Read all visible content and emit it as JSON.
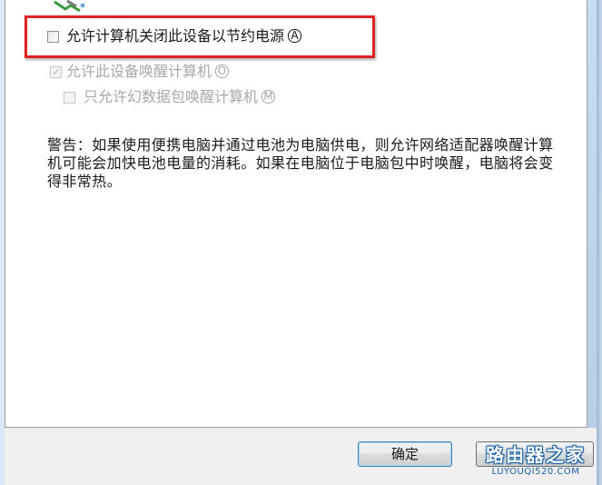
{
  "options": {
    "allow_power_off": {
      "label": "允许计算机关闭此设备以节约电源",
      "hotkey": "A",
      "checked": false
    },
    "allow_wake": {
      "label": "允许此设备唤醒计算机",
      "hotkey": "O",
      "checked": true,
      "disabled": true
    },
    "magic_packet_only": {
      "label": "只允许幻数据包唤醒计算机",
      "hotkey": "M",
      "checked": false,
      "disabled": true
    }
  },
  "warning_text": "警告：如果使用便携电脑并通过电池为电脑供电，则允许网络适配器唤醒计算机可能会加快电池电量的消耗。如果在电脑位于电脑包中时唤醒，电脑将会变得非常热。",
  "buttons": {
    "ok_label": "确定",
    "cancel_label": ""
  },
  "watermark": {
    "title": "路由器之家",
    "url": "LUYOUQI520.COM"
  },
  "colors": {
    "highlight": "#e02222",
    "default_button_border": "#3c7fb1",
    "watermark_blue": "#1b5fa5"
  },
  "icons": {
    "device": "network-adapter-icon",
    "checkmark": "✓"
  }
}
